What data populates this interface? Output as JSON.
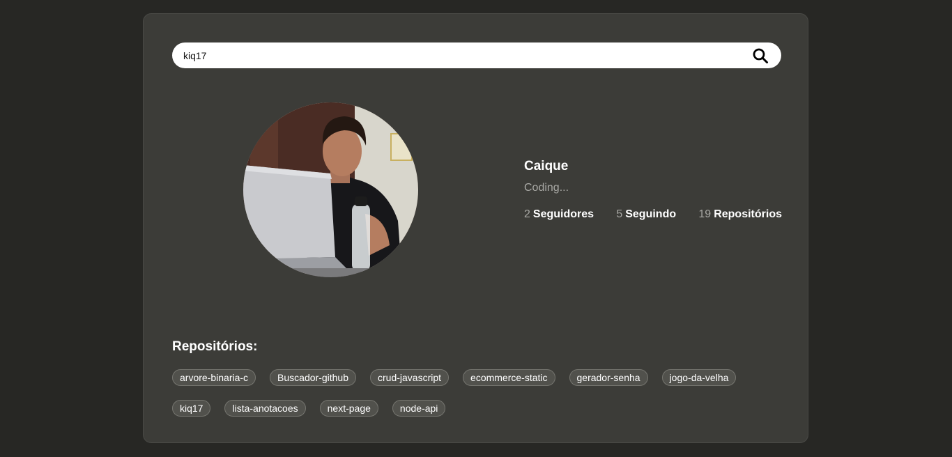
{
  "search": {
    "value": "kiq17",
    "icon": "search-icon"
  },
  "profile": {
    "name": "Caique",
    "bio": "Coding...",
    "followers_count": "2",
    "followers_label": "Seguidores",
    "following_count": "5",
    "following_label": "Seguindo",
    "repos_count": "19",
    "repos_label": "Repositórios"
  },
  "repositories": {
    "title": "Repositórios:",
    "items": [
      "arvore-binaria-c",
      "Buscador-github",
      "crud-javascript",
      "ecommerce-static",
      "gerador-senha",
      "jogo-da-velha",
      "kiq17",
      "lista-anotacoes",
      "next-page",
      "node-api"
    ]
  },
  "colors": {
    "background": "#272724",
    "card": "#3c3c38",
    "tag_background": "#51514c",
    "muted_text": "#a9a9a5"
  }
}
